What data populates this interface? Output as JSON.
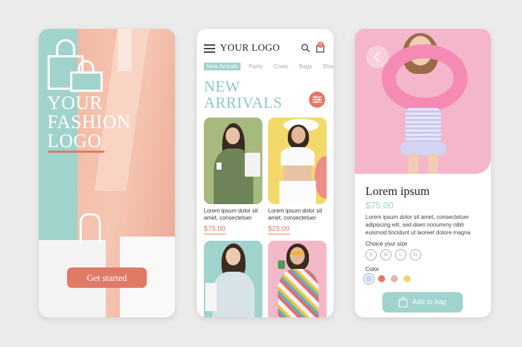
{
  "screen1": {
    "logo_lines": [
      "YOUR",
      "FASHION",
      "LOGO"
    ],
    "get_started_label": "Get started"
  },
  "screen2": {
    "header": {
      "logo": "YOUR LOGO",
      "cart_count": "0"
    },
    "tabs": [
      {
        "label": "New Arrivals",
        "active": true
      },
      {
        "label": "Pants",
        "active": false
      },
      {
        "label": "Coats",
        "active": false
      },
      {
        "label": "Bags",
        "active": false
      },
      {
        "label": "Shoes",
        "active": false
      }
    ],
    "heading_lines": [
      "NEW",
      "ARRIVALS"
    ],
    "products": [
      {
        "description": "Lorem ipsum dolor sit amet, consectetuer",
        "price": "$75.00"
      },
      {
        "description": "Lorem ipsum dolor sit amet, consectetuer",
        "price": "$25.00"
      }
    ]
  },
  "screen3": {
    "product_name": "Lorem ipsum",
    "price": "$75.00",
    "description": "Lorem ipsum dolor sit amet, consectetuer adipiscing elit, sed diam nonummy nibh euismod tincidunt ut laoreet dolore magna",
    "size_label": "Choice your size",
    "sizes": [
      "S",
      "M",
      "L",
      "XL"
    ],
    "color_label": "Color",
    "colors": [
      "#c9d6f2",
      "#e07a66",
      "#e3b6b0",
      "#f2d36b"
    ],
    "add_to_bag_label": "Add to bag"
  },
  "theme": {
    "accent": "#e07a66",
    "mint": "#9fd3cc",
    "pink": "#f4b6cb"
  }
}
